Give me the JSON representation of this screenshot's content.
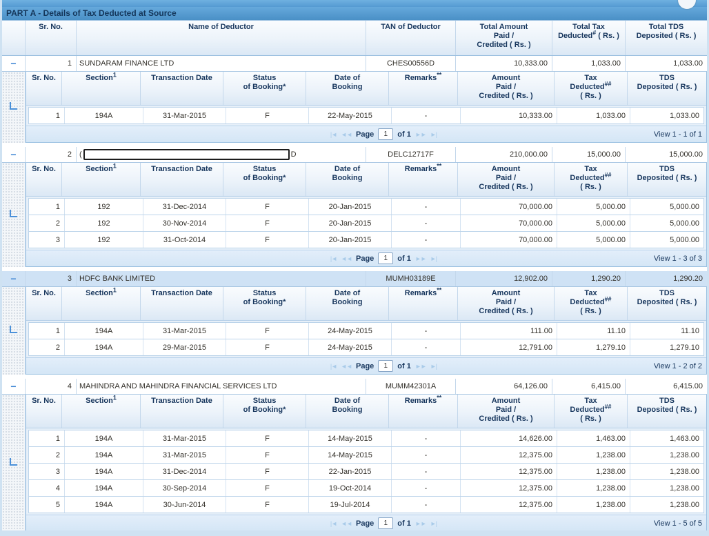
{
  "title": "PART A - Details of Tax Deducted at Source",
  "colors": {
    "accent": "#5b9bd5",
    "header_text": "#17365d",
    "highlight_row_bg": "#cfe2f5",
    "frame": "#cfe2f2"
  },
  "icons": {
    "collapse": "−",
    "close": "circle",
    "elbow": "L-corner"
  },
  "main_headers": {
    "sr": "Sr. No.",
    "name": "Name of Deductor",
    "tan": "TAN of Deductor",
    "total_amount": {
      "line1": "Total Amount",
      "line2": "Paid /",
      "line3": "Credited ( Rs. )"
    },
    "total_tax": {
      "line1": "Total Tax",
      "line2_word": "Deducted",
      "sup": "#",
      "line2_rest": " ( Rs. )"
    },
    "total_tds": {
      "line1": "Total TDS",
      "line2": "Deposited ( Rs. )"
    }
  },
  "sub_headers": {
    "sr": "Sr. No.",
    "section": {
      "label": "Section",
      "sup": "1"
    },
    "txn_date": "Transaction Date",
    "status": {
      "line1": "Status",
      "line2": "of Booking*"
    },
    "booking_date": {
      "line1": "Date of",
      "line2": "Booking"
    },
    "remarks": {
      "label": "Remarks",
      "sup": "**"
    },
    "amount": {
      "line1": "Amount",
      "line2": "Paid /",
      "line3": "Credited ( Rs. )"
    },
    "tax": {
      "line1": "Tax",
      "line2_word": "Deducted",
      "sup": "##",
      "line3": "( Rs. )"
    },
    "tds": {
      "line1": "TDS",
      "line2": "Deposited ( Rs. )"
    }
  },
  "pagination": {
    "first": "|◄",
    "prev": "◄◄",
    "page_label": "Page",
    "page_value": "1",
    "of_label": "of 1",
    "next": "►►",
    "last": "►|"
  },
  "deductors": [
    {
      "sr_no": "1",
      "name_prefix": "",
      "name": "SUNDARAM FINANCE LTD",
      "name_suffix": "",
      "redacted": false,
      "tan": "CHES00556D",
      "total_amount": "10,333.00",
      "total_tax": "1,033.00",
      "total_tds": "1,033.00",
      "highlighted": false,
      "view_label": "View 1 - 1 of 1",
      "rows": [
        {
          "sr": "1",
          "section": "194A",
          "txn_date": "31-Mar-2015",
          "status": "F",
          "booking_date": "22-May-2015",
          "remarks": "-",
          "amount": "10,333.00",
          "tax": "1,033.00",
          "tds": "1,033.00"
        }
      ]
    },
    {
      "sr_no": "2",
      "name_prefix": "(",
      "name": "",
      "name_suffix": "D",
      "redacted": true,
      "tan": "DELC12717F",
      "total_amount": "210,000.00",
      "total_tax": "15,000.00",
      "total_tds": "15,000.00",
      "highlighted": false,
      "view_label": "View 1 - 3 of 3",
      "rows": [
        {
          "sr": "1",
          "section": "192",
          "txn_date": "31-Dec-2014",
          "status": "F",
          "booking_date": "20-Jan-2015",
          "remarks": "-",
          "amount": "70,000.00",
          "tax": "5,000.00",
          "tds": "5,000.00"
        },
        {
          "sr": "2",
          "section": "192",
          "txn_date": "30-Nov-2014",
          "status": "F",
          "booking_date": "20-Jan-2015",
          "remarks": "-",
          "amount": "70,000.00",
          "tax": "5,000.00",
          "tds": "5,000.00"
        },
        {
          "sr": "3",
          "section": "192",
          "txn_date": "31-Oct-2014",
          "status": "F",
          "booking_date": "20-Jan-2015",
          "remarks": "-",
          "amount": "70,000.00",
          "tax": "5,000.00",
          "tds": "5,000.00"
        }
      ]
    },
    {
      "sr_no": "3",
      "name_prefix": "",
      "name": "HDFC BANK LIMITED",
      "name_suffix": "",
      "redacted": false,
      "tan": "MUMH03189E",
      "total_amount": "12,902.00",
      "total_tax": "1,290.20",
      "total_tds": "1,290.20",
      "highlighted": true,
      "view_label": "View 1 - 2 of 2",
      "rows": [
        {
          "sr": "1",
          "section": "194A",
          "txn_date": "31-Mar-2015",
          "status": "F",
          "booking_date": "24-May-2015",
          "remarks": "-",
          "amount": "111.00",
          "tax": "11.10",
          "tds": "11.10"
        },
        {
          "sr": "2",
          "section": "194A",
          "txn_date": "29-Mar-2015",
          "status": "F",
          "booking_date": "24-May-2015",
          "remarks": "-",
          "amount": "12,791.00",
          "tax": "1,279.10",
          "tds": "1,279.10"
        }
      ]
    },
    {
      "sr_no": "4",
      "name_prefix": "",
      "name": "MAHINDRA AND MAHINDRA FINANCIAL SERVICES LTD",
      "name_suffix": "",
      "redacted": false,
      "tan": "MUMM42301A",
      "total_amount": "64,126.00",
      "total_tax": "6,415.00",
      "total_tds": "6,415.00",
      "highlighted": false,
      "view_label": "View 1 - 5 of 5",
      "rows": [
        {
          "sr": "1",
          "section": "194A",
          "txn_date": "31-Mar-2015",
          "status": "F",
          "booking_date": "14-May-2015",
          "remarks": "-",
          "amount": "14,626.00",
          "tax": "1,463.00",
          "tds": "1,463.00"
        },
        {
          "sr": "2",
          "section": "194A",
          "txn_date": "31-Mar-2015",
          "status": "F",
          "booking_date": "14-May-2015",
          "remarks": "-",
          "amount": "12,375.00",
          "tax": "1,238.00",
          "tds": "1,238.00"
        },
        {
          "sr": "3",
          "section": "194A",
          "txn_date": "31-Dec-2014",
          "status": "F",
          "booking_date": "22-Jan-2015",
          "remarks": "-",
          "amount": "12,375.00",
          "tax": "1,238.00",
          "tds": "1,238.00"
        },
        {
          "sr": "4",
          "section": "194A",
          "txn_date": "30-Sep-2014",
          "status": "F",
          "booking_date": "19-Oct-2014",
          "remarks": "-",
          "amount": "12,375.00",
          "tax": "1,238.00",
          "tds": "1,238.00"
        },
        {
          "sr": "5",
          "section": "194A",
          "txn_date": "30-Jun-2014",
          "status": "F",
          "booking_date": "19-Jul-2014",
          "remarks": "-",
          "amount": "12,375.00",
          "tax": "1,238.00",
          "tds": "1,238.00"
        }
      ]
    }
  ]
}
